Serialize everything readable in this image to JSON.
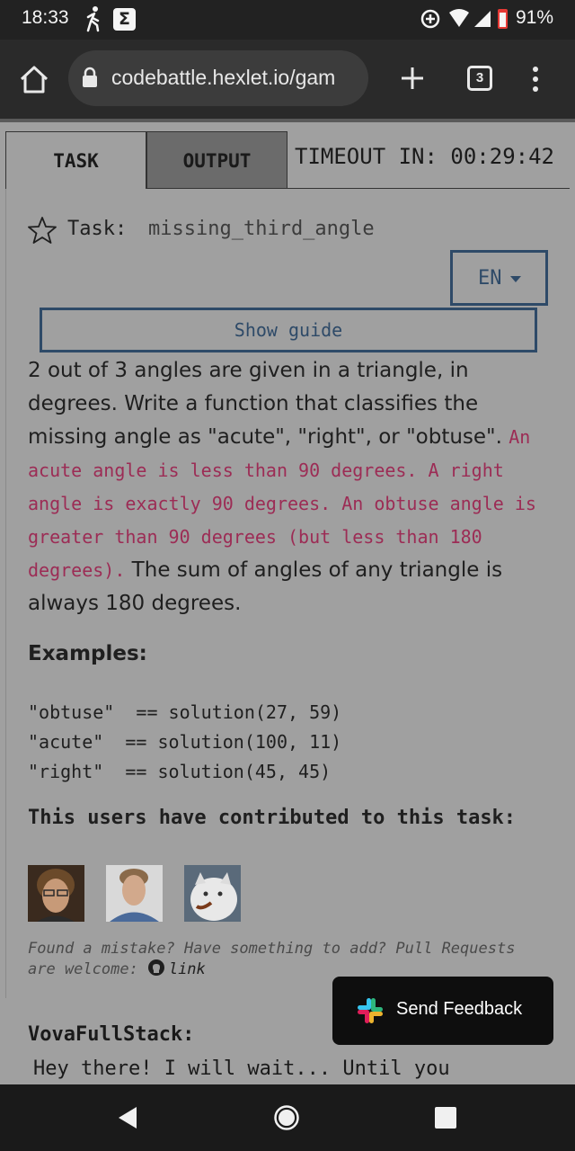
{
  "status_bar": {
    "time": "18:33",
    "battery": "91%",
    "icons": [
      "walk-icon",
      "sigma-icon",
      "data-saver-icon",
      "wifi-icon",
      "signal-icon",
      "battery-icon"
    ]
  },
  "browser": {
    "url": "codebattle.hexlet.io/gam",
    "tab_count": "3",
    "icons": [
      "home-icon",
      "lock-icon",
      "new-tab-icon",
      "tab-switcher-icon",
      "more-menu-icon"
    ]
  },
  "tabs": {
    "task": "TASK",
    "output": "OUTPUT"
  },
  "timeout": "TIMEOUT IN: 00:29:42",
  "task": {
    "label": "Task:",
    "name": "missing_third_angle",
    "language": "EN",
    "guide_button": "Show guide",
    "description_intro": "2 out of 3 angles are given in a triangle, in degrees. Write a function that classifies the missing angle as \"acute\", \"right\", or \"obtuse\". ",
    "description_code": "An acute angle is less than 90 degrees. A right angle is exactly 90 degrees. An obtuse angle is greater than 90 degrees (but less than 180 degrees).",
    "description_end": " The sum of angles of any triangle is always 180 degrees.",
    "examples_heading": "Examples:",
    "examples": [
      "\"obtuse\"  == solution(27, 59)",
      "\"acute\"  == solution(100, 11)",
      "\"right\"  == solution(45, 45)"
    ],
    "contributors_heading": "This users have contributed to this task:",
    "found_mistake": "Found a mistake? Have something to add? Pull Requests are welcome:",
    "link_text": "link"
  },
  "chat": {
    "user": "VovaFullStack:",
    "message": "Hey there! I will wait... Until you"
  },
  "feedback": {
    "label": "Send Feedback"
  },
  "colors": {
    "page_bg": "#a0a0a0",
    "accent_blue": "#2e4a68",
    "code_red": "#9c2c55",
    "status_bar": "#222222"
  }
}
